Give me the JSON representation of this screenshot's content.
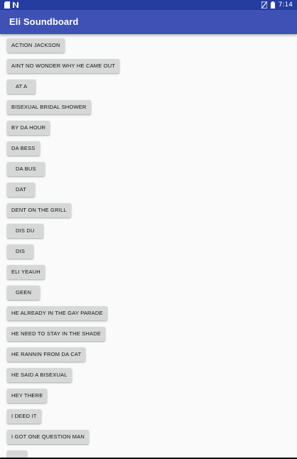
{
  "status_bar": {
    "time": "7:14",
    "icons": [
      "sd-card-icon",
      "n-notification-icon",
      "no-sim-icon",
      "battery-icon"
    ]
  },
  "app_bar": {
    "title": "Eli Soundboard"
  },
  "sounds": [
    "ACTION JACKSON",
    "AINT NO WONDER WHY HE CAME OUT",
    "AT A",
    "BISEXUAL BRIDAL SHOWER",
    "BY DA HOUR",
    "DA BESS",
    "DA BUS",
    "DAT",
    "DENT ON THE GRILL",
    "DIS DU",
    "DIS",
    "ELI YEAUH",
    "GEEN",
    "HE ALREADY IN THE GAY PARADE",
    "HE NEED TO STAY IN THE SHADE",
    "HE RANNIN FROM DA CAT",
    "HE SAID A BISEXUAL",
    "HEY THERE",
    "I DEED IT",
    "I GOT ONE QUESTION MAN",
    ""
  ],
  "colors": {
    "status_bar": "#253da0",
    "app_bar": "#3f51b5",
    "button": "#d6d7d7",
    "background": "#fafafa"
  }
}
